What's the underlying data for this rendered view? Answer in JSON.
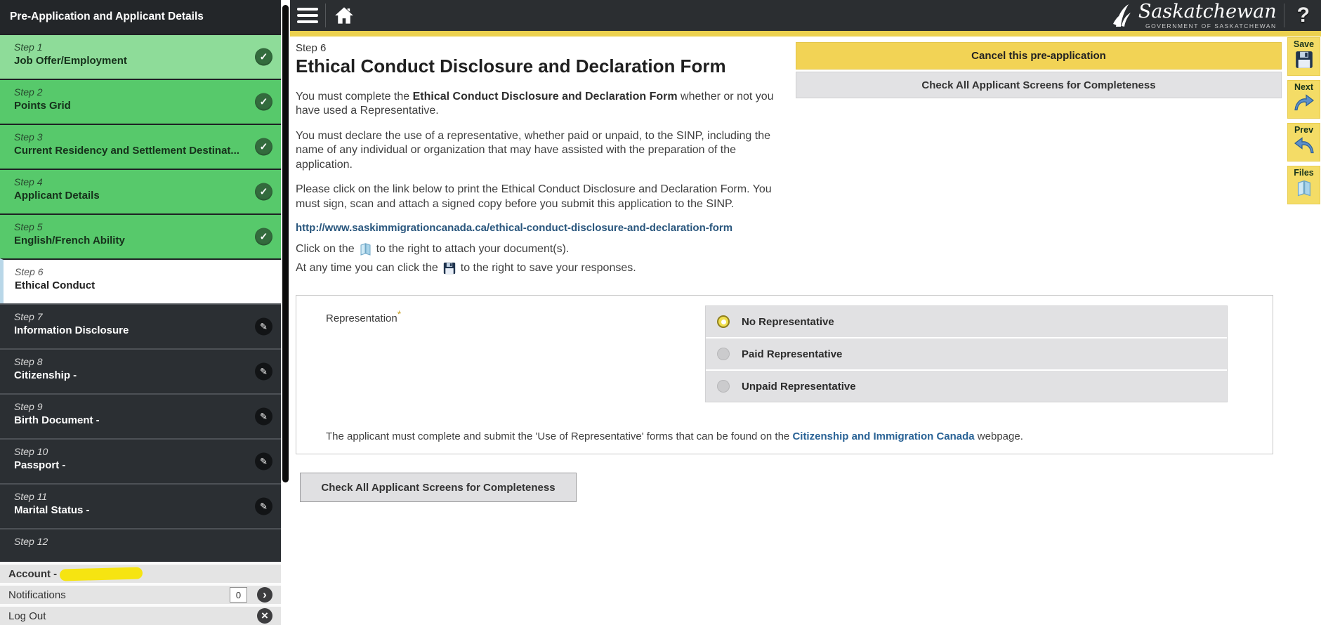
{
  "sidebar": {
    "header": "Pre-Application and Applicant Details",
    "steps": [
      {
        "step": "Step 1",
        "title": "Job Offer/Employment",
        "status": "complete"
      },
      {
        "step": "Step 2",
        "title": "Points Grid",
        "status": "complete"
      },
      {
        "step": "Step 3",
        "title": "Current Residency and Settlement Destinat...",
        "status": "complete"
      },
      {
        "step": "Step 4",
        "title": "Applicant Details",
        "status": "complete"
      },
      {
        "step": "Step 5",
        "title": "English/French Ability",
        "status": "complete"
      },
      {
        "step": "Step 6",
        "title": "Ethical Conduct",
        "status": "current"
      },
      {
        "step": "Step 7",
        "title": "Information Disclosure",
        "status": "pending"
      },
      {
        "step": "Step 8",
        "title": "Citizenship -",
        "status": "pending"
      },
      {
        "step": "Step 9",
        "title": "Birth Document -",
        "status": "pending"
      },
      {
        "step": "Step 10",
        "title": "Passport -",
        "status": "pending"
      },
      {
        "step": "Step 11",
        "title": "Marital Status -",
        "status": "pending"
      },
      {
        "step": "Step 12",
        "title": "",
        "status": "pending"
      }
    ],
    "account": {
      "label": "Account -",
      "notifications_label": "Notifications",
      "notifications_count": "0",
      "logout_label": "Log Out"
    }
  },
  "topbar": {
    "brand": "Saskatchewan",
    "brand_sub": "GOVERNMENT OF SASKATCHEWAN"
  },
  "icons": {
    "check": "✓",
    "pencil": "✎",
    "chevron": "›",
    "close": "×",
    "help": "?"
  },
  "actions": {
    "cancel": "Cancel this pre-application",
    "check_all_top": "Check All Applicant Screens for Completeness",
    "check_all_bottom": "Check All Applicant Screens for Completeness"
  },
  "toolbar": {
    "save": "Save",
    "next": "Next",
    "prev": "Prev",
    "files": "Files"
  },
  "content": {
    "step_label": "Step 6",
    "title": "Ethical Conduct Disclosure and Declaration Form",
    "p1_a": "You must complete the ",
    "p1_b": "Ethical Conduct Disclosure and Declaration Form",
    "p1_c": " whether or not you have used a Representative.",
    "p2": "You must declare the use of a representative, whether paid or unpaid, to the SINP, including the name of any individual or organization that may have assisted with the preparation of the application.",
    "p3": "Please click on the link below to print the Ethical Conduct Disclosure and Declaration Form. You must sign, scan and attach a signed copy before you submit this application to the SINP.",
    "link": "http://www.saskimmigrationcanada.ca/ethical-conduct-disclosure-and-declaration-form",
    "attach_pre": "Click on the",
    "attach_post": "to the right to attach your document(s).",
    "save_pre": "At any time you can click the",
    "save_post": "to the right to save your responses."
  },
  "form": {
    "label": "Representation",
    "required": "*",
    "options": [
      {
        "label": "No Representative",
        "selected": true
      },
      {
        "label": "Paid Representative",
        "selected": false
      },
      {
        "label": "Unpaid Representative",
        "selected": false
      }
    ],
    "note_a": "The applicant must complete and submit the 'Use of Representative' forms that can be found on the ",
    "note_link": "Citizenship and Immigration Canada",
    "note_b": " webpage."
  },
  "colors": {
    "accent_yellow": "#ECD14F",
    "button_yellow": "#F2D355",
    "sidebar_green": "#57C96B",
    "sidebar_green_light": "#8EDC99",
    "dark_panel": "#2B2F33",
    "link_blue": "#2A6396",
    "button_gray": "#E2E2E4",
    "selected_radio_gold": "#F0DF4E"
  }
}
